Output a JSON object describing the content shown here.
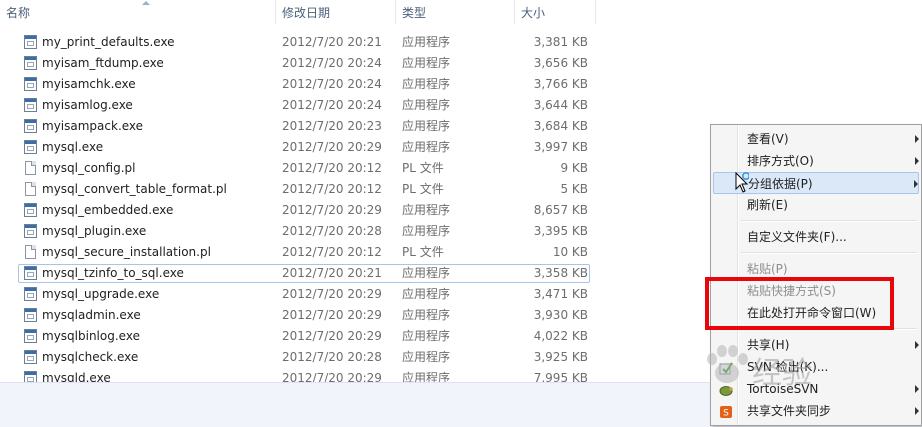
{
  "columns": {
    "name": "名称",
    "date": "修改日期",
    "type": "类型",
    "size": "大小"
  },
  "files": [
    {
      "name": "my_print_defaults.exe",
      "date": "2012/7/20 20:21",
      "type": "应用程序",
      "size": "3,381 KB",
      "icon": "exe"
    },
    {
      "name": "myisam_ftdump.exe",
      "date": "2012/7/20 20:24",
      "type": "应用程序",
      "size": "3,656 KB",
      "icon": "exe"
    },
    {
      "name": "myisamchk.exe",
      "date": "2012/7/20 20:24",
      "type": "应用程序",
      "size": "3,766 KB",
      "icon": "exe"
    },
    {
      "name": "myisamlog.exe",
      "date": "2012/7/20 20:24",
      "type": "应用程序",
      "size": "3,644 KB",
      "icon": "exe"
    },
    {
      "name": "myisampack.exe",
      "date": "2012/7/20 20:23",
      "type": "应用程序",
      "size": "3,684 KB",
      "icon": "exe"
    },
    {
      "name": "mysql.exe",
      "date": "2012/7/20 20:29",
      "type": "应用程序",
      "size": "3,997 KB",
      "icon": "exe"
    },
    {
      "name": "mysql_config.pl",
      "date": "2012/7/20 20:12",
      "type": "PL 文件",
      "size": "9 KB",
      "icon": "pl"
    },
    {
      "name": "mysql_convert_table_format.pl",
      "date": "2012/7/20 20:12",
      "type": "PL 文件",
      "size": "5 KB",
      "icon": "pl"
    },
    {
      "name": "mysql_embedded.exe",
      "date": "2012/7/20 20:29",
      "type": "应用程序",
      "size": "8,657 KB",
      "icon": "exe"
    },
    {
      "name": "mysql_plugin.exe",
      "date": "2012/7/20 20:28",
      "type": "应用程序",
      "size": "3,395 KB",
      "icon": "exe"
    },
    {
      "name": "mysql_secure_installation.pl",
      "date": "2012/7/20 20:12",
      "type": "PL 文件",
      "size": "10 KB",
      "icon": "pl"
    },
    {
      "name": "mysql_tzinfo_to_sql.exe",
      "date": "2012/7/20 20:21",
      "type": "应用程序",
      "size": "3,358 KB",
      "icon": "exe",
      "selected": true
    },
    {
      "name": "mysql_upgrade.exe",
      "date": "2012/7/20 20:29",
      "type": "应用程序",
      "size": "3,471 KB",
      "icon": "exe"
    },
    {
      "name": "mysqladmin.exe",
      "date": "2012/7/20 20:29",
      "type": "应用程序",
      "size": "3,930 KB",
      "icon": "exe"
    },
    {
      "name": "mysqlbinlog.exe",
      "date": "2012/7/20 20:29",
      "type": "应用程序",
      "size": "4,022 KB",
      "icon": "exe"
    },
    {
      "name": "mysqlcheck.exe",
      "date": "2012/7/20 20:28",
      "type": "应用程序",
      "size": "3,925 KB",
      "icon": "exe"
    },
    {
      "name": "mysqld.exe",
      "date": "2012/7/20 20:29",
      "type": "应用程序",
      "size": "7,995 KB",
      "icon": "exe"
    }
  ],
  "context_menu": {
    "items": [
      {
        "label": "查看(V)",
        "submenu": true
      },
      {
        "label": "排序方式(O)",
        "submenu": true
      },
      {
        "label": "分组依据(P)",
        "submenu": true,
        "highlighted": true
      },
      {
        "label": "刷新(E)"
      },
      {
        "separator": true
      },
      {
        "label": "自定义文件夹(F)..."
      },
      {
        "separator": true
      },
      {
        "label": "粘贴(P)",
        "disabled": true
      },
      {
        "label": "粘贴快捷方式(S)",
        "disabled": true
      },
      {
        "label": "在此处打开命令窗口(W)"
      },
      {
        "separator": true
      },
      {
        "label": "共享(H)",
        "submenu": true
      },
      {
        "label": "SVN 检出(K)...",
        "icon": "svn-checkout-icon"
      },
      {
        "label": "TortoiseSVN",
        "submenu": true,
        "icon": "tortoisesvn-icon"
      },
      {
        "label": "共享文件夹同步",
        "submenu": true,
        "icon": "folder-sync-icon"
      }
    ]
  },
  "watermark": {
    "text": "经验"
  },
  "colors": {
    "highlight_box": "#e8060c",
    "menu_bg": "#f5f5f5",
    "hover": "#dbe8f8"
  }
}
